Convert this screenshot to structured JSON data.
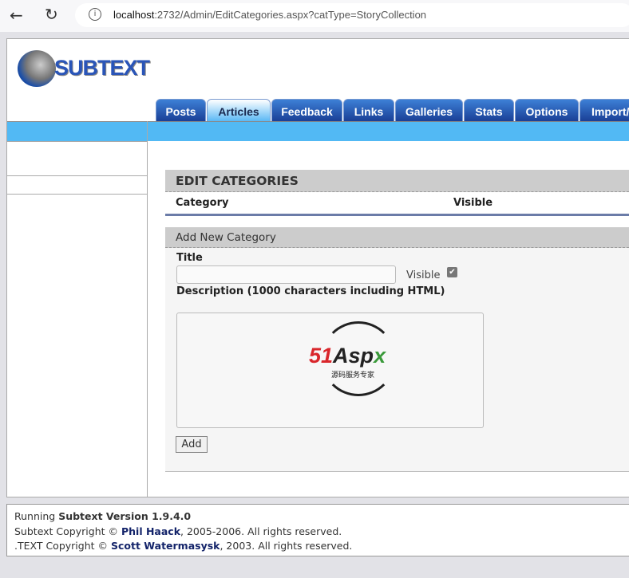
{
  "browser": {
    "url_host": "localhost",
    "url_rest": ":2732/Admin/EditCategories.aspx?catType=StoryCollection"
  },
  "logo": {
    "text": "SUBTEXT"
  },
  "tabs": [
    {
      "label": "Posts"
    },
    {
      "label": "Articles"
    },
    {
      "label": "Feedback"
    },
    {
      "label": "Links"
    },
    {
      "label": "Galleries"
    },
    {
      "label": "Stats"
    },
    {
      "label": "Options"
    },
    {
      "label": "Import/"
    }
  ],
  "edit": {
    "title": "EDIT CATEGORIES",
    "col_category": "Category",
    "col_visible": "Visible"
  },
  "add": {
    "title": "Add New Category",
    "title_label": "Title",
    "title_value": "",
    "visible_label": "Visible",
    "visible_checked": true,
    "description_label": "Description (1000 characters including HTML)",
    "add_button": "Add"
  },
  "watermark": {
    "brand": "51Aspx",
    "tagline": "源码服务专家"
  },
  "footer": {
    "running": "Running ",
    "version": "Subtext Version 1.9.4.0",
    "line2_pre": "Subtext Copyright © ",
    "line2_link": "Phil Haack",
    "line2_post": ", 2005-2006. All rights reserved.",
    "line3_pre": ".TEXT Copyright © ",
    "line3_link": "Scott Watermasysk",
    "line3_post": ", 2003. All rights reserved."
  }
}
